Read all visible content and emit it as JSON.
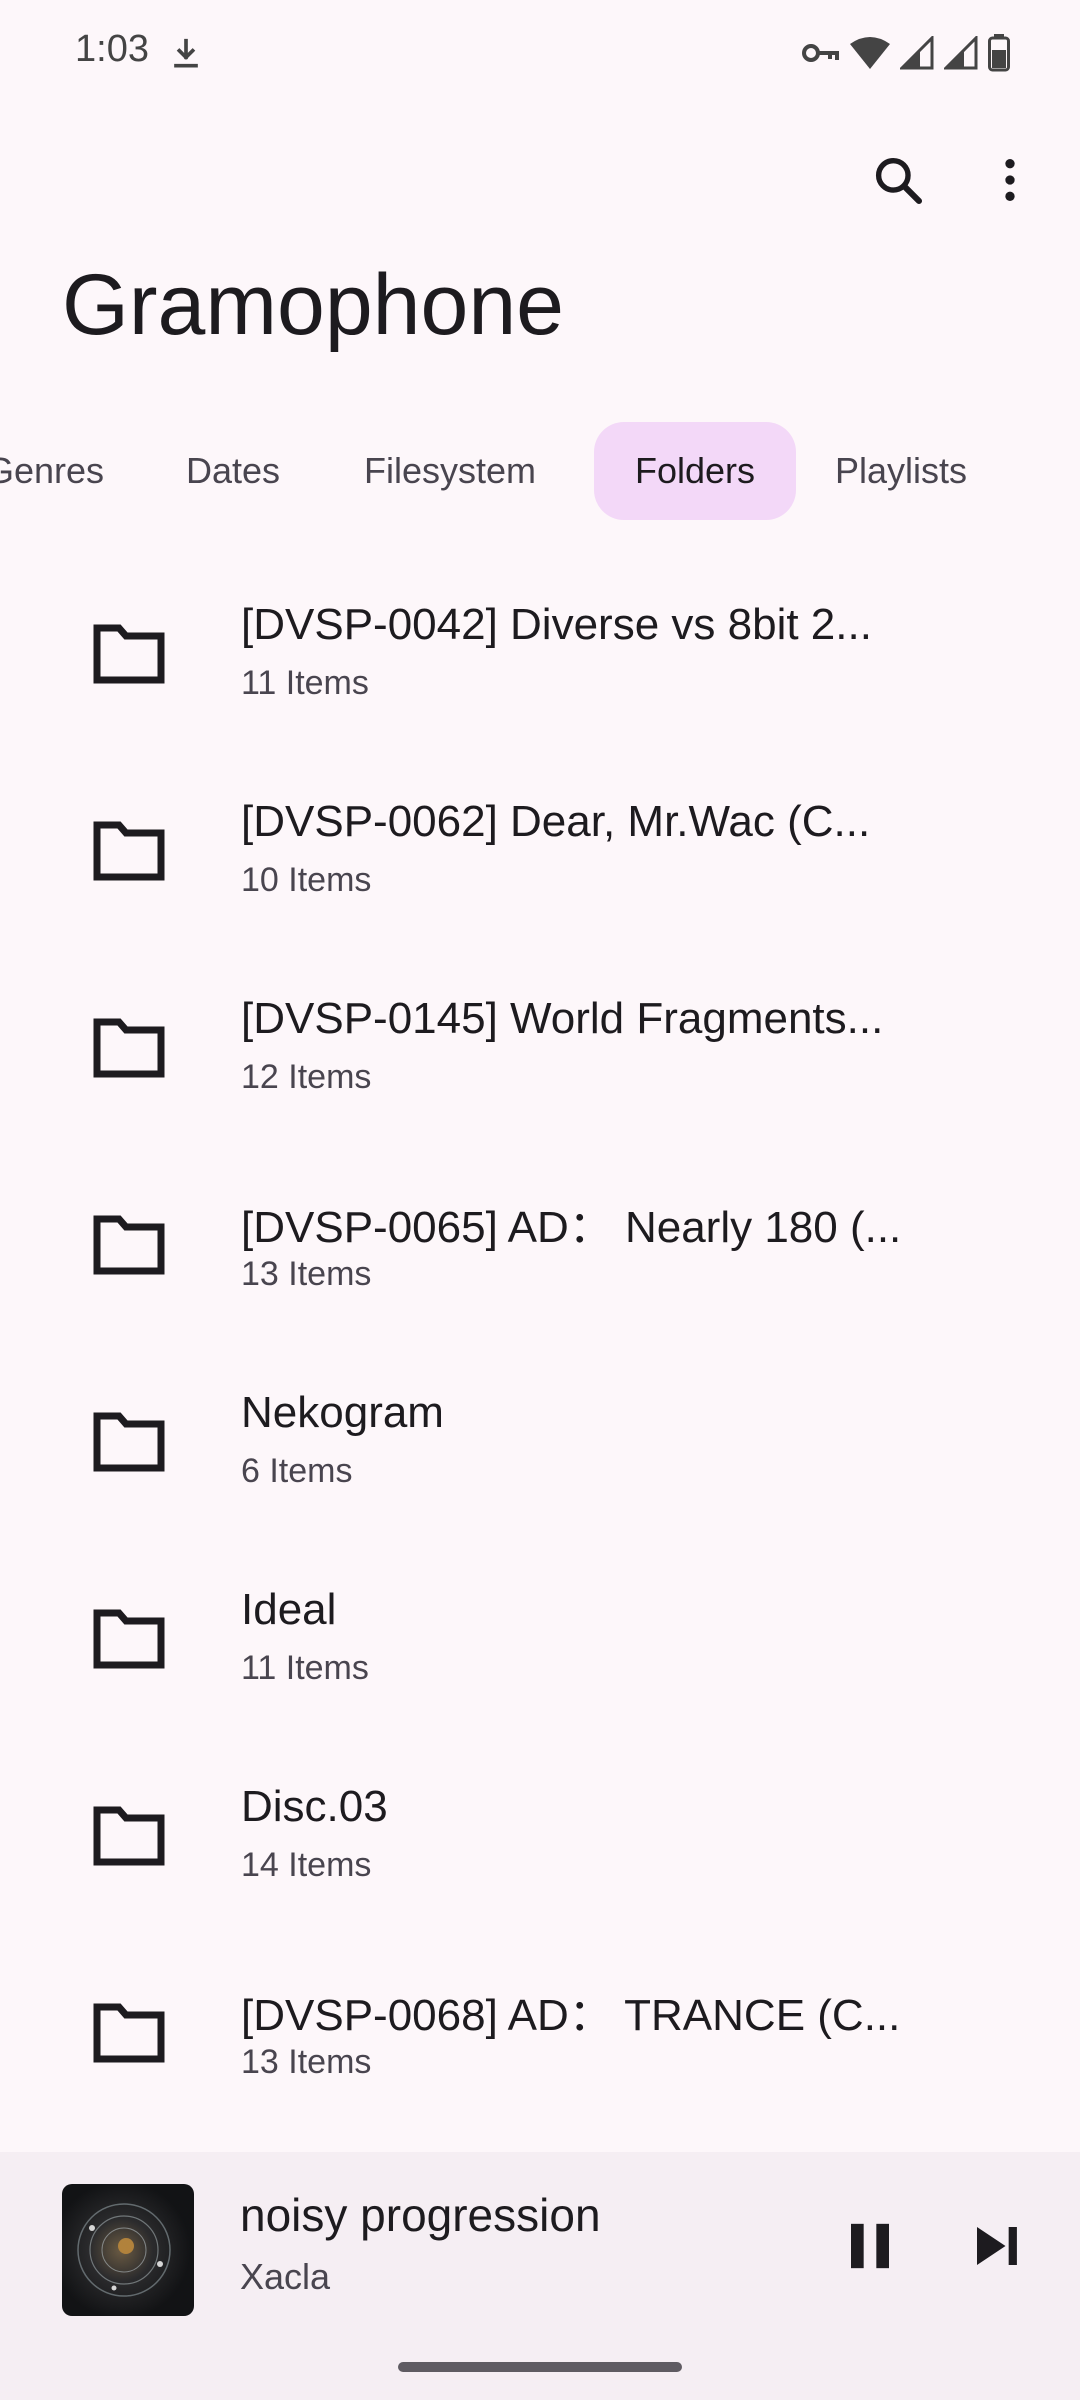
{
  "status_bar": {
    "time": "1:03",
    "icons": [
      "download-icon",
      "vpn-key-icon",
      "wifi-icon",
      "cell-signal-icon",
      "cell-signal-icon",
      "battery-icon"
    ]
  },
  "app": {
    "title": "Gramophone",
    "actions": [
      "search-icon",
      "more-vert-icon"
    ]
  },
  "tabs": [
    {
      "label": "Genres",
      "active": false
    },
    {
      "label": "Dates",
      "active": false
    },
    {
      "label": "Filesystem",
      "active": false
    },
    {
      "label": "Folders",
      "active": true
    },
    {
      "label": "Playlists",
      "active": false
    }
  ],
  "folders": [
    {
      "name": "[DVSP-0042] Diverse vs 8bit 2...",
      "count": "11 Items"
    },
    {
      "name": "[DVSP-0062] Dear, Mr.Wac (C...",
      "count": "10 Items"
    },
    {
      "name": "[DVSP-0145] World Fragments...",
      "count": "12 Items"
    },
    {
      "name": "[DVSP-0065] AD： Nearly 180 (...",
      "count": "13 Items"
    },
    {
      "name": "Nekogram",
      "count": "6 Items"
    },
    {
      "name": "Ideal",
      "count": "11 Items"
    },
    {
      "name": "Disc.03",
      "count": "14 Items"
    },
    {
      "name": "[DVSP-0068] AD： TRANCE (C...",
      "count": "13 Items"
    }
  ],
  "player": {
    "title": "noisy progression",
    "artist": "Xacla",
    "state": "playing"
  },
  "colors": {
    "background": "#fdf7fa",
    "active_tab": "#f3d8f8",
    "player_bg": "#f5eef3",
    "text_primary": "#1d1b1f",
    "text_secondary": "#49454f"
  }
}
